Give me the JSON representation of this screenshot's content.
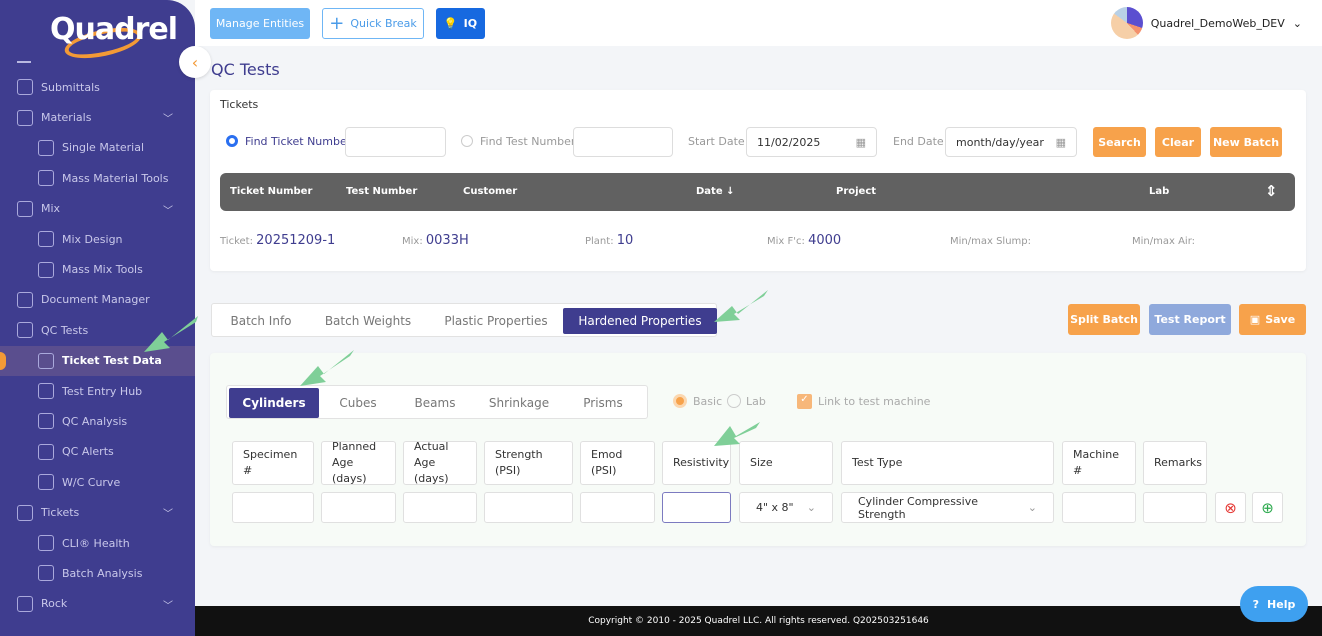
{
  "brand": {
    "logo": "Quadrel"
  },
  "sidebar": {
    "items": [
      {
        "label": "Submittals",
        "level": "top",
        "icon": "document-icon"
      },
      {
        "label": "Materials",
        "level": "top",
        "icon": "layers-icon",
        "chevron": true
      },
      {
        "label": "Single Material",
        "level": "sub",
        "icon": "layers-icon"
      },
      {
        "label": "Mass Material Tools",
        "level": "sub",
        "icon": "tools-icon"
      },
      {
        "label": "Mix",
        "level": "top",
        "icon": "mix-icon",
        "chevron": true
      },
      {
        "label": "Mix Design",
        "level": "sub",
        "icon": "mix-design-icon"
      },
      {
        "label": "Mass Mix Tools",
        "level": "sub",
        "icon": "nodes-icon"
      },
      {
        "label": "Document Manager",
        "level": "top",
        "icon": "folder-icon"
      },
      {
        "label": "QC Tests",
        "level": "top",
        "icon": "calculator-icon"
      },
      {
        "label": "Ticket Test Data",
        "level": "sub",
        "icon": "edit-icon",
        "active": true
      },
      {
        "label": "Test Entry Hub",
        "level": "sub",
        "icon": "hub-icon"
      },
      {
        "label": "QC Analysis",
        "level": "sub",
        "icon": "bar-chart-icon"
      },
      {
        "label": "QC Alerts",
        "level": "sub",
        "icon": "alert-icon"
      },
      {
        "label": "W/C Curve",
        "level": "sub",
        "icon": "curve-icon"
      },
      {
        "label": "Tickets",
        "level": "top",
        "icon": "tickets-icon",
        "chevron": true
      },
      {
        "label": "CLI® Health",
        "level": "sub",
        "icon": "health-icon"
      },
      {
        "label": "Batch Analysis",
        "level": "sub",
        "icon": "batch-icon"
      },
      {
        "label": "Rock",
        "level": "top",
        "icon": "rock-icon",
        "chevron": true
      }
    ]
  },
  "topbar": {
    "manage": "Manage Entities",
    "quick": "Quick Break",
    "iq": "IQ",
    "user": "Quadrel_DemoWeb_DEV"
  },
  "page": {
    "title": "QC Tests"
  },
  "tickets": {
    "title": "Tickets",
    "find_ticket": "Find Ticket Number",
    "find_ticket_value": "",
    "find_test": "Find Test Number",
    "find_test_value": "",
    "start_label": "Start Date",
    "start_value": "11/02/2025",
    "end_label": "End Date",
    "end_placeholder": "month/day/year",
    "search": "Search",
    "clear": "Clear",
    "new_batch": "New Batch",
    "columns": [
      "Ticket Number",
      "Test Number",
      "Customer",
      "Date ↓",
      "Project",
      "Lab"
    ],
    "info": {
      "ticket_label": "Ticket:",
      "ticket": "20251209-1",
      "mix_label": "Mix:",
      "mix": "0033H",
      "plant_label": "Plant:",
      "plant": "10",
      "fc_label": "Mix F'c:",
      "fc": "4000",
      "slump_label": "Min/max Slump:",
      "air_label": "Min/max Air:"
    }
  },
  "tabs": [
    "Batch Info",
    "Batch Weights",
    "Plastic Properties",
    "Hardened Properties"
  ],
  "actions": {
    "split": "Split Batch",
    "report": "Test Report",
    "save": "Save"
  },
  "hardened": {
    "subtabs": [
      "Cylinders",
      "Cubes",
      "Beams",
      "Shrinkage",
      "Prisms"
    ],
    "basic": "Basic",
    "lab": "Lab",
    "link": "Link to test machine",
    "headers": [
      "Specimen #",
      "Planned Age (days)",
      "Actual Age (days)",
      "Strength (PSI)",
      "Emod (PSI)",
      "Resistivity",
      "Size",
      "Test Type",
      "Machine #",
      "Remarks"
    ],
    "size": "4\" x 8\"",
    "test_type": "Cylinder Compressive Strength"
  },
  "footer": "Copyright © 2010 - 2025 Quadrel LLC. All rights reserved. Q202503251646",
  "help": "Help"
}
